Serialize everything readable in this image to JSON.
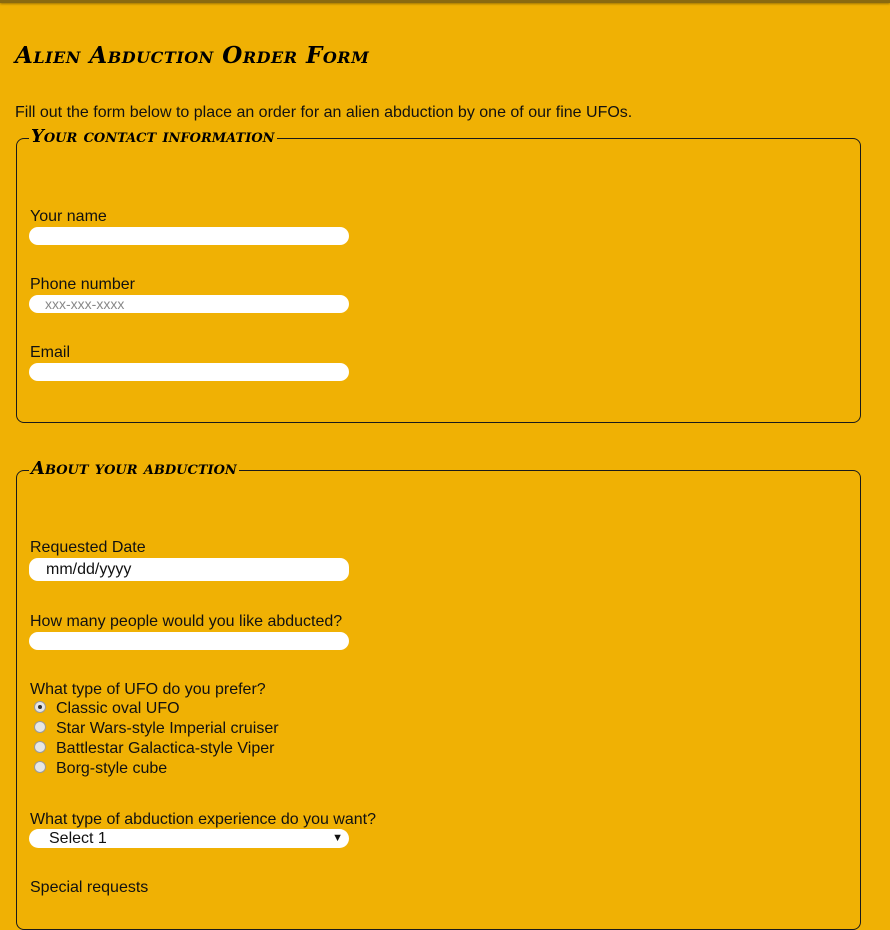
{
  "page": {
    "title": "Alien Abduction Order Form",
    "intro": "Fill out the form below to place an order for an alien abduction by one of our fine UFOs."
  },
  "contact": {
    "legend": "Your contact information",
    "name_label": "Your name",
    "name_value": "",
    "phone_label": "Phone number",
    "phone_placeholder": "xxx-xxx-xxxx",
    "email_label": "Email",
    "email_value": ""
  },
  "abduction": {
    "legend": "About your abduction",
    "date_label": "Requested Date",
    "date_placeholder": "mm/dd/yyyy",
    "people_label": "How many people would you like abducted?",
    "people_value": "",
    "ufo_label": "What type of UFO do you prefer?",
    "ufo_options": [
      {
        "label": "Classic oval UFO",
        "checked": true
      },
      {
        "label": "Star Wars-style Imperial cruiser",
        "checked": false
      },
      {
        "label": "Battlestar Galactica-style Viper",
        "checked": false
      },
      {
        "label": "Borg-style cube",
        "checked": false
      }
    ],
    "experience_label": "What type of abduction experience do you want?",
    "experience_selected": "Select 1",
    "experience_arrow": "▼",
    "special_label": "Special requests"
  },
  "colors": {
    "background": "#f0b104",
    "input_bg": "#ffffff",
    "border": "#1a1a1a"
  }
}
